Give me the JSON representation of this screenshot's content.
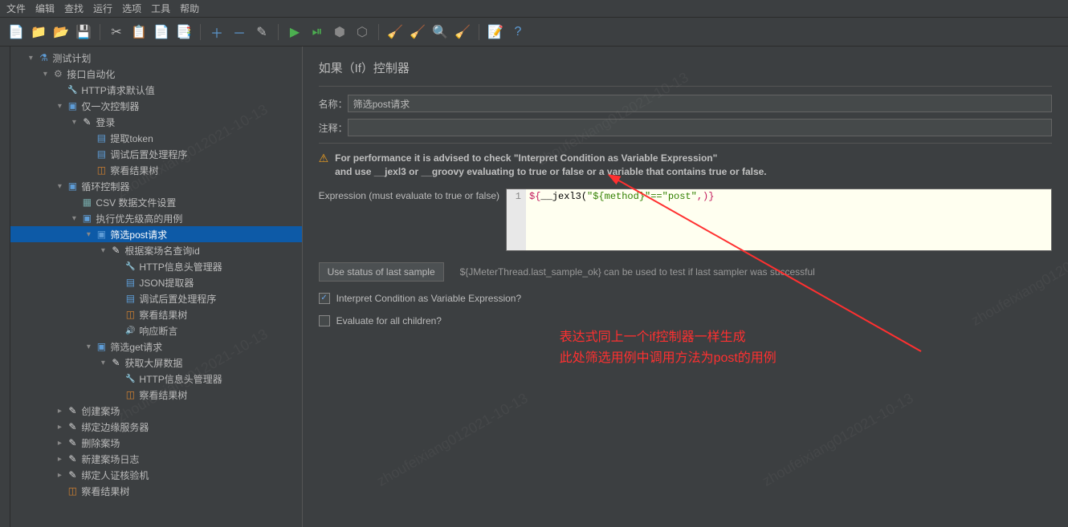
{
  "menu": [
    "文件",
    "编辑",
    "查找",
    "运行",
    "选项",
    "工具",
    "帮助"
  ],
  "tree": [
    {
      "d": 0,
      "e": "▾",
      "i": "icon-flask",
      "t": "测试计划"
    },
    {
      "d": 1,
      "e": "▾",
      "i": "icon-gear",
      "t": "接口自动化"
    },
    {
      "d": 2,
      "e": "",
      "i": "icon-wrench",
      "t": "HTTP请求默认值"
    },
    {
      "d": 2,
      "e": "▾",
      "i": "icon-folder",
      "t": "仅一次控制器"
    },
    {
      "d": 3,
      "e": "▾",
      "i": "icon-pencil",
      "t": "登录"
    },
    {
      "d": 4,
      "e": "",
      "i": "icon-doc",
      "t": "提取token"
    },
    {
      "d": 4,
      "e": "",
      "i": "icon-doc",
      "t": "调试后置处理程序"
    },
    {
      "d": 4,
      "e": "",
      "i": "icon-tree",
      "t": "察看结果树"
    },
    {
      "d": 2,
      "e": "▾",
      "i": "icon-folder",
      "t": "循环控制器"
    },
    {
      "d": 3,
      "e": "",
      "i": "icon-doc2",
      "t": "CSV 数据文件设置"
    },
    {
      "d": 3,
      "e": "▾",
      "i": "icon-folder",
      "t": "执行优先级高的用例"
    },
    {
      "d": 4,
      "e": "▾",
      "i": "icon-folder",
      "t": "筛选post请求",
      "sel": true
    },
    {
      "d": 5,
      "e": "▾",
      "i": "icon-pencil",
      "t": "根据案场名查询id"
    },
    {
      "d": 6,
      "e": "",
      "i": "icon-wrench",
      "t": "HTTP信息头管理器"
    },
    {
      "d": 6,
      "e": "",
      "i": "icon-doc",
      "t": "JSON提取器"
    },
    {
      "d": 6,
      "e": "",
      "i": "icon-doc",
      "t": "调试后置处理程序"
    },
    {
      "d": 6,
      "e": "",
      "i": "icon-tree",
      "t": "察看结果树"
    },
    {
      "d": 6,
      "e": "",
      "i": "icon-sound",
      "t": "响应断言"
    },
    {
      "d": 4,
      "e": "▾",
      "i": "icon-folder",
      "t": "筛选get请求"
    },
    {
      "d": 5,
      "e": "▾",
      "i": "icon-pencil",
      "t": "获取大屏数据"
    },
    {
      "d": 6,
      "e": "",
      "i": "icon-wrench",
      "t": "HTTP信息头管理器"
    },
    {
      "d": 6,
      "e": "",
      "i": "icon-tree",
      "t": "察看结果树"
    },
    {
      "d": 2,
      "e": "▸",
      "i": "icon-pencil",
      "t": "创建案场"
    },
    {
      "d": 2,
      "e": "▸",
      "i": "icon-pencil",
      "t": "绑定边缘服务器"
    },
    {
      "d": 2,
      "e": "▸",
      "i": "icon-pencil",
      "t": "删除案场"
    },
    {
      "d": 2,
      "e": "▸",
      "i": "icon-pencil",
      "t": "新建案场日志"
    },
    {
      "d": 2,
      "e": "▸",
      "i": "icon-pencil",
      "t": "绑定人证核验机"
    },
    {
      "d": 2,
      "e": "",
      "i": "icon-tree",
      "t": "察看结果树"
    }
  ],
  "panel": {
    "title": "如果（If）控制器",
    "name_label": "名称：",
    "name_value": "筛选post请求",
    "comment_label": "注释：",
    "comment_value": "",
    "warn1": "For performance it is advised to check \"Interpret Condition as Variable Expression\"",
    "warn2": "and use __jexl3 or __groovy evaluating to true or false or a variable that contains true or false.",
    "expr_label": "Expression (must evaluate to true or false)",
    "gutter": "1",
    "code_p1": "${",
    "code_p2": "__jexl3(",
    "code_p3": "\"${method}\"==\"post\"",
    "code_p4": ",)}",
    "btn_status": "Use status of last sample",
    "hint": "${JMeterThread.last_sample_ok} can be used to test if last sampler was successful",
    "cb1": "Interpret Condition as Variable Expression?",
    "cb2": "Evaluate for all children?"
  },
  "annotation": {
    "line1": "表达式同上一个if控制器一样生成",
    "line2": "此处筛选用例中调用方法为post的用例"
  },
  "watermark": "zhoufeixiang012021-10-13"
}
